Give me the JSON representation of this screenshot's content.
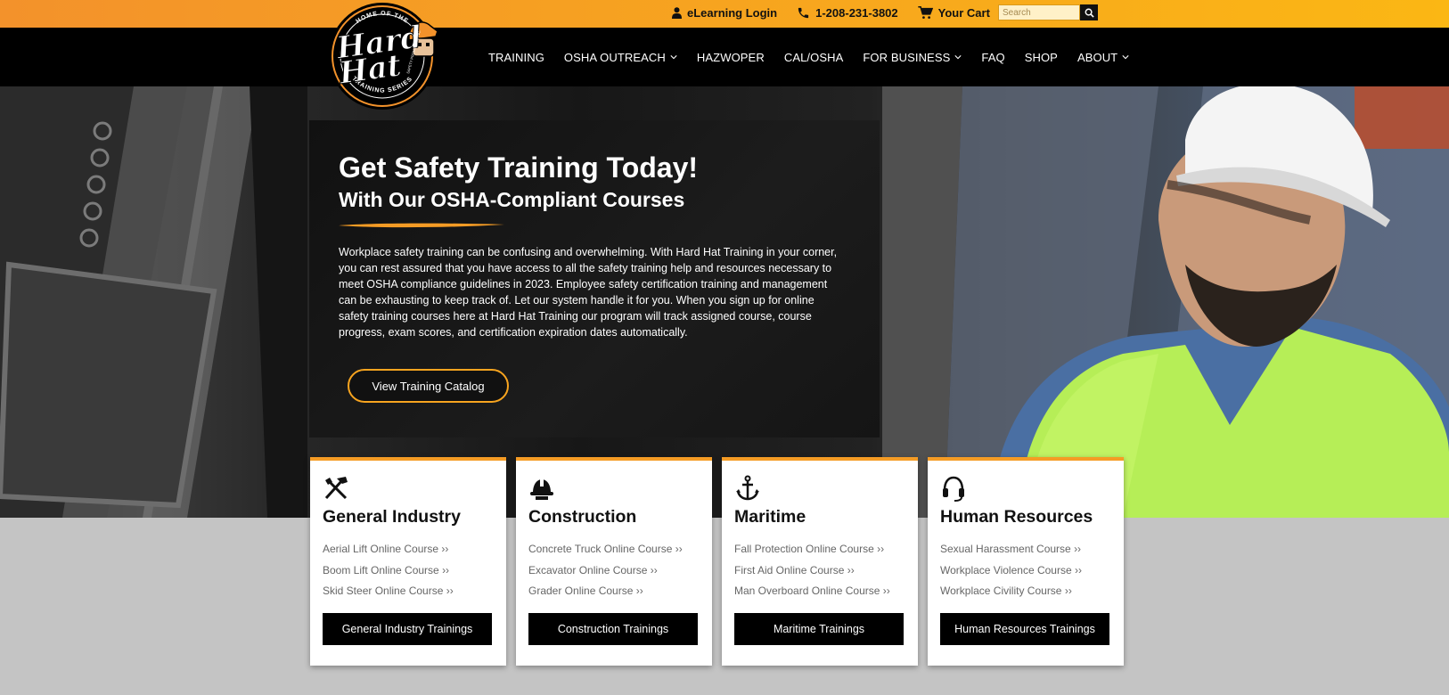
{
  "topbar": {
    "elearning_label": "eLearning Login",
    "phone_label": "1-208-231-3802",
    "cart_label": "Your Cart",
    "search_placeholder": "Search"
  },
  "logo": {
    "top_text": "HOME OF THE",
    "word1": "Hard",
    "word2": "Hat",
    "side_text": "SAFETY PROVISIONS INC.",
    "bottom_text": "TRAINING SERIES"
  },
  "nav": {
    "items": [
      {
        "label": "TRAINING",
        "dropdown": false
      },
      {
        "label": "OSHA OUTREACH",
        "dropdown": true
      },
      {
        "label": "HAZWOPER",
        "dropdown": false
      },
      {
        "label": "CAL/OSHA",
        "dropdown": false
      },
      {
        "label": "FOR BUSINESS",
        "dropdown": true
      },
      {
        "label": "FAQ",
        "dropdown": false
      },
      {
        "label": "SHOP",
        "dropdown": false
      },
      {
        "label": "ABOUT",
        "dropdown": true
      }
    ]
  },
  "hero": {
    "title": "Get Safety Training Today!",
    "subtitle": "With Our OSHA-Compliant Courses",
    "body": "Workplace safety training can be confusing and overwhelming. With Hard Hat Training in your corner, you can rest assured that you have access to all the safety training help and resources necessary to meet OSHA compliance guidelines in 2023. Employee safety certification training and management can be exhausting to keep track of. Let our system handle it for you. When you sign up for online safety training courses here at Hard Hat Training our program will track assigned course, course progress, exam scores, and certification expiration dates automatically.",
    "cta_label": "View Training Catalog"
  },
  "cards": [
    {
      "icon": "tools-icon",
      "title": "General Industry",
      "links": [
        "Aerial Lift Online Course ››",
        "Boom Lift Online Course ››",
        "Skid Steer Online Course ››"
      ],
      "button": "General Industry Trainings"
    },
    {
      "icon": "hardhat-icon",
      "title": "Construction",
      "links": [
        "Concrete Truck Online Course ››",
        "Excavator Online Course ››",
        "Grader Online Course ››"
      ],
      "button": "Construction Trainings"
    },
    {
      "icon": "anchor-icon",
      "title": "Maritime",
      "links": [
        "Fall Protection Online Course ››",
        "First Aid Online Course ››",
        "Man Overboard Online Course ››"
      ],
      "button": "Maritime Trainings"
    },
    {
      "icon": "headset-icon",
      "title": "Human Resources",
      "links": [
        "Sexual Harassment Course ››",
        "Workplace Violence Course ››",
        "Workplace Civility Course ››"
      ],
      "button": "Human Resources Trainings"
    }
  ],
  "colors": {
    "accent_orange": "#f59c25",
    "topbar_start": "#f3922b",
    "topbar_end": "#fbb714",
    "nav_bg": "#000000",
    "page_bg": "#c4c4c4"
  }
}
